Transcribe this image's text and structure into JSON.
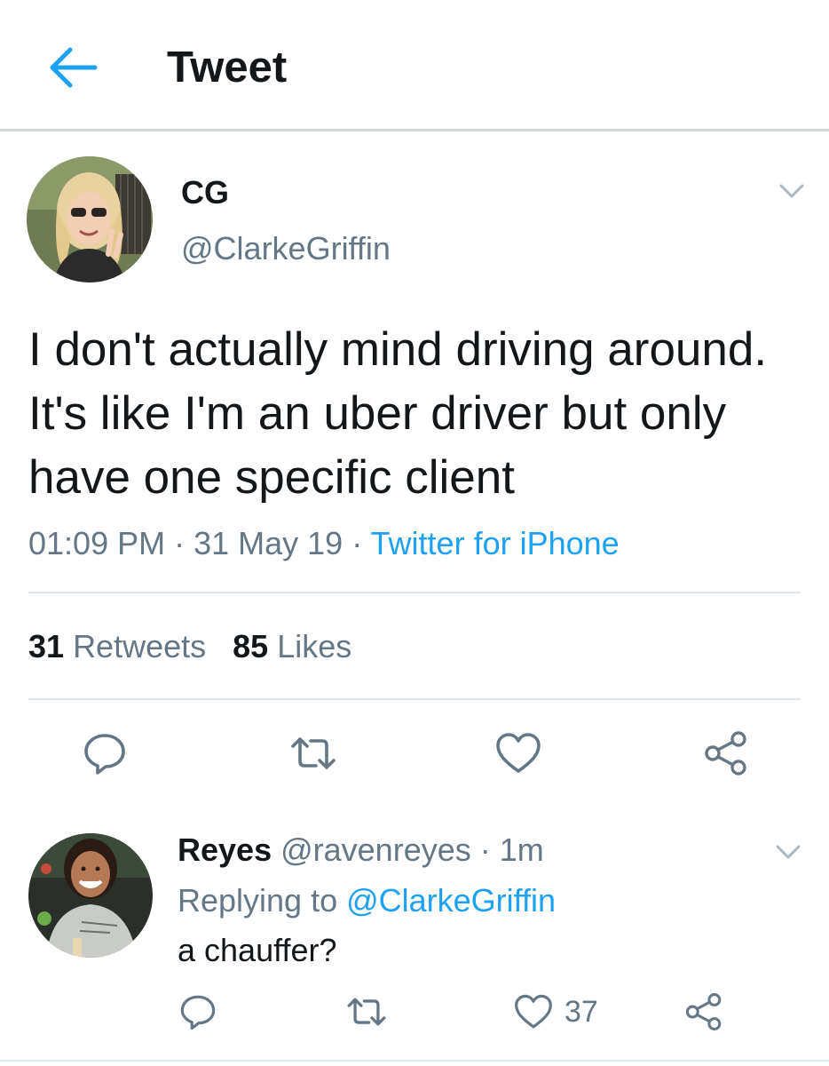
{
  "header": {
    "title": "Tweet",
    "back_icon": "arrow-left-icon",
    "accent_color": "#1da1f2"
  },
  "tweet": {
    "display_name": "CG",
    "handle": "@ClarkeGriffin",
    "text": "I don't actually mind driving around. It's like I'm an uber driver but only have one specific client",
    "time": "01:09 PM",
    "separator": " · ",
    "date": "31 May 19",
    "source": "Twitter for iPhone",
    "retweets_count": "31",
    "retweets_label": "Retweets",
    "likes_count": "85",
    "likes_label": "Likes",
    "actions": [
      "reply-icon",
      "retweet-icon",
      "like-icon",
      "share-icon"
    ]
  },
  "reply": {
    "display_name": "Reyes",
    "handle": "@ravenreyes",
    "separator": " · ",
    "time_ago": "1m",
    "replying_prefix": "Replying to ",
    "replying_to": "@ClarkeGriffin",
    "text": "a chauffer?",
    "like_count": "37",
    "actions": [
      "reply-icon",
      "retweet-icon",
      "like-icon",
      "share-icon"
    ]
  },
  "colors": {
    "text_primary": "#14171a",
    "text_secondary": "#657786",
    "link": "#1da1f2",
    "divider": "#e1e8ed"
  }
}
